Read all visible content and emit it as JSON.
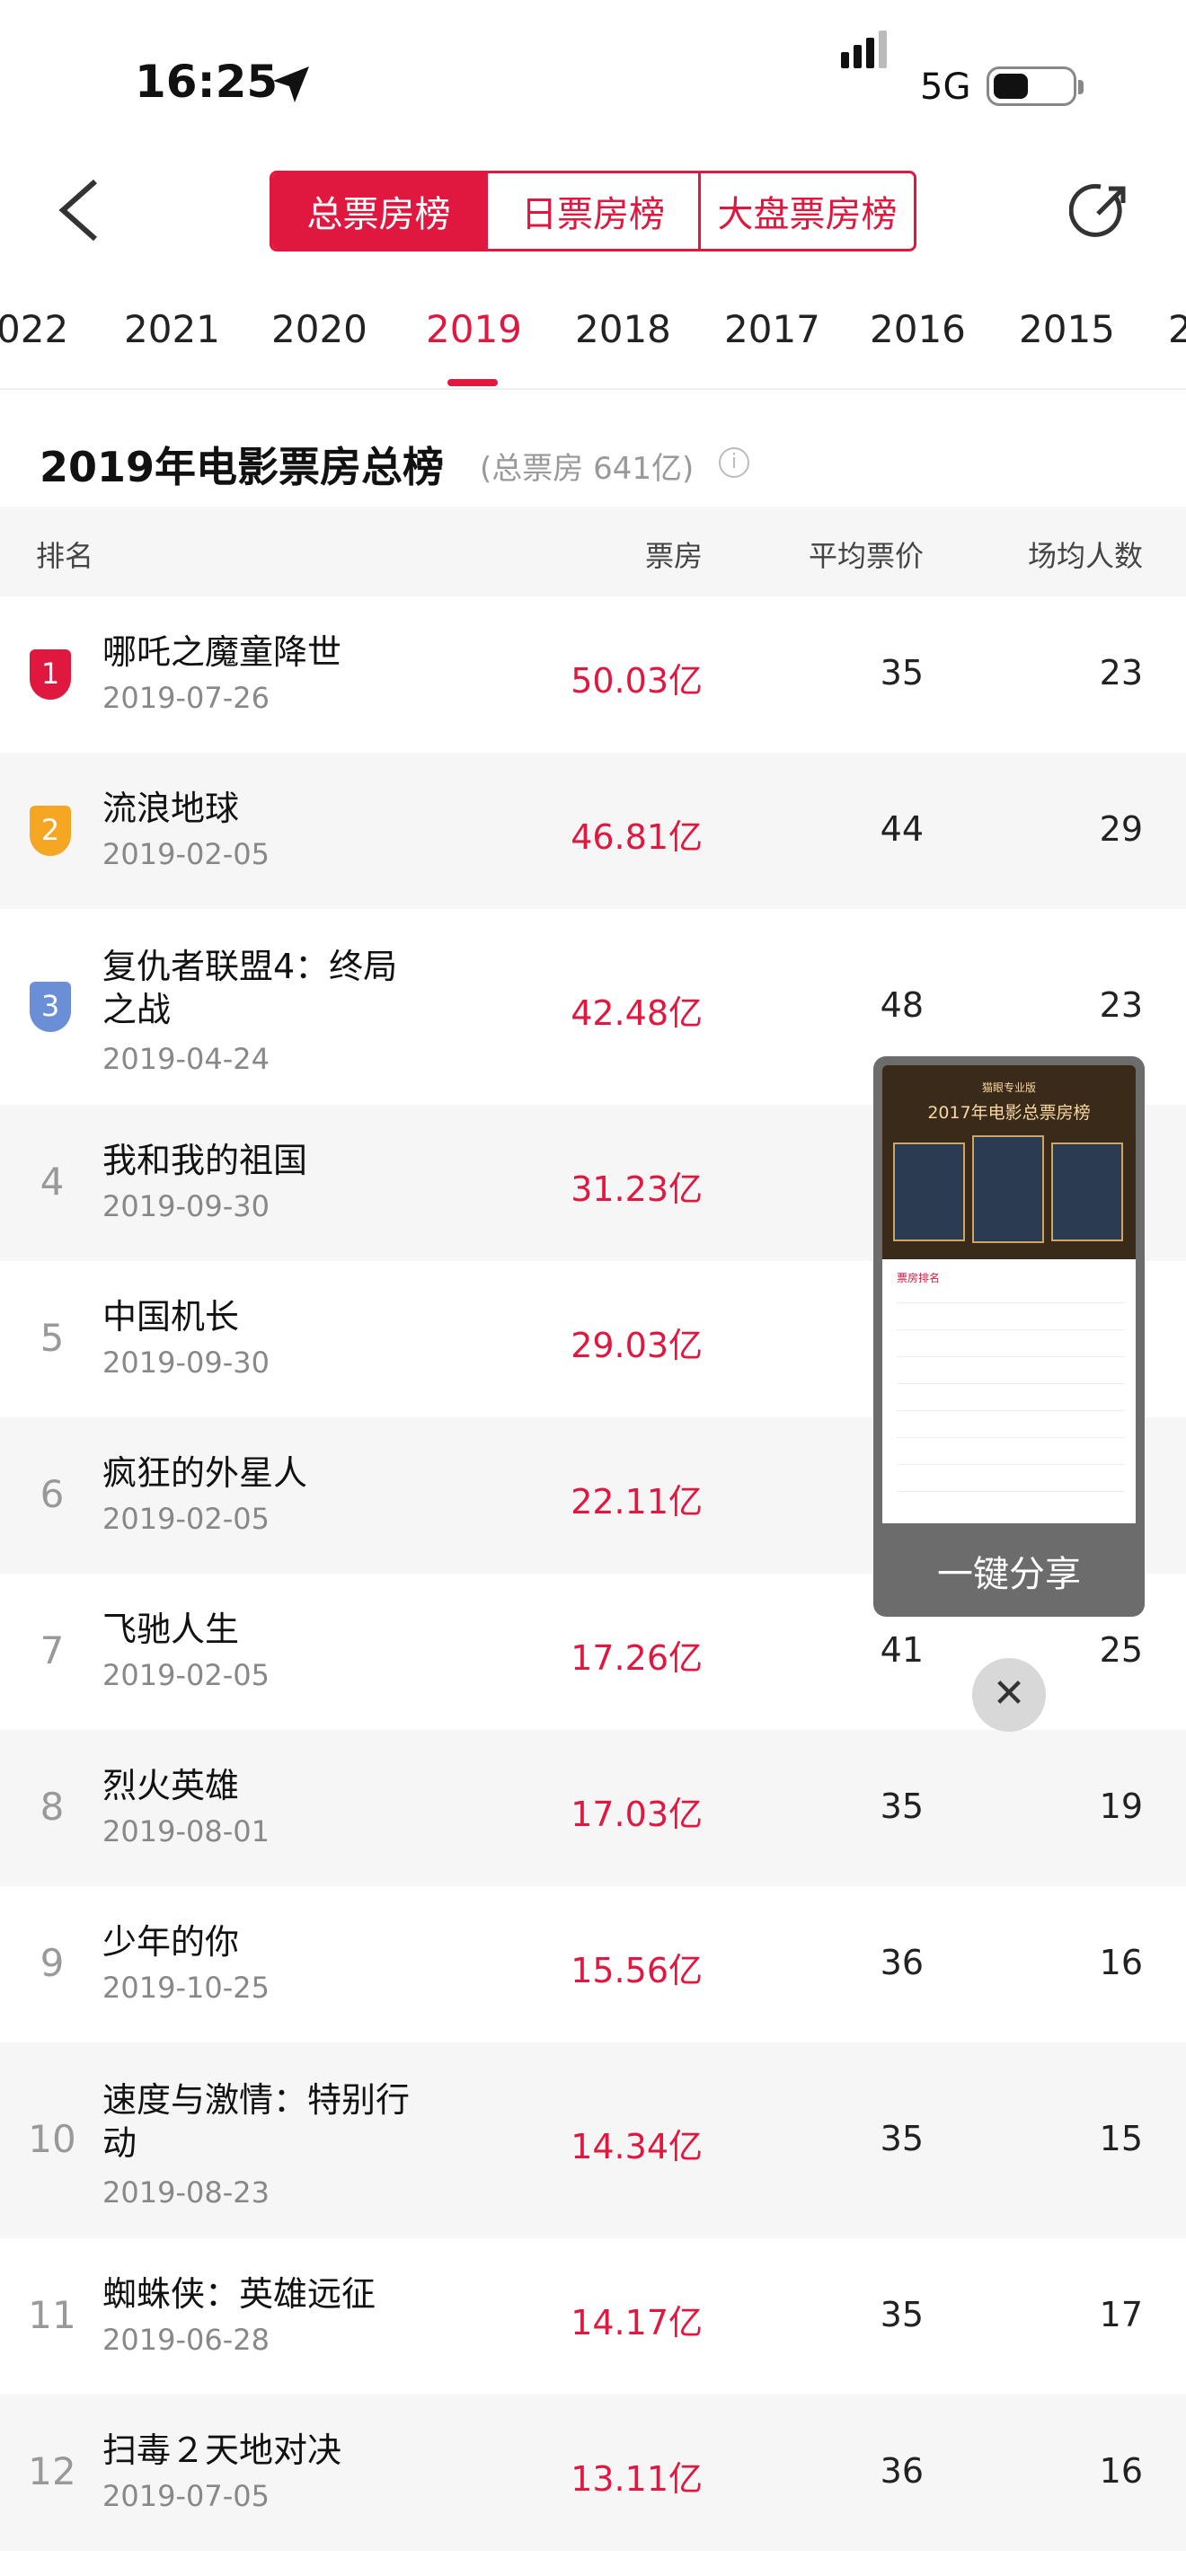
{
  "status_bar": {
    "time": "16:25",
    "network": "5G"
  },
  "header": {
    "tabs": [
      "总票房榜",
      "日票房榜",
      "大盘票房榜"
    ]
  },
  "years": [
    "022",
    "2021",
    "2020",
    "2019",
    "2018",
    "2017",
    "2016",
    "2015",
    "2"
  ],
  "active_year": "2019",
  "title": "2019年电影票房总榜",
  "total": "(总票房 641亿)",
  "table_header": {
    "rank": "排名",
    "box": "票房",
    "price": "平均票价",
    "people": "场均人数"
  },
  "movies": [
    {
      "rank": "1",
      "name": "哪吒之魔童降世",
      "date": "2019-07-26",
      "box": "50.03亿",
      "price": "35",
      "people": "23"
    },
    {
      "rank": "2",
      "name": "流浪地球",
      "date": "2019-02-05",
      "box": "46.81亿",
      "price": "44",
      "people": "29"
    },
    {
      "rank": "3",
      "name": "复仇者联盟4：终局之战",
      "date": "2019-04-24",
      "box": "42.48亿",
      "price": "48",
      "people": "23"
    },
    {
      "rank": "4",
      "name": "我和我的祖国",
      "date": "2019-09-30",
      "box": "31.23亿",
      "price": "",
      "people": ""
    },
    {
      "rank": "5",
      "name": "中国机长",
      "date": "2019-09-30",
      "box": "29.03亿",
      "price": "",
      "people": ""
    },
    {
      "rank": "6",
      "name": "疯狂的外星人",
      "date": "2019-02-05",
      "box": "22.11亿",
      "price": "",
      "people": ""
    },
    {
      "rank": "7",
      "name": "飞驰人生",
      "date": "2019-02-05",
      "box": "17.26亿",
      "price": "41",
      "people": "25"
    },
    {
      "rank": "8",
      "name": "烈火英雄",
      "date": "2019-08-01",
      "box": "17.03亿",
      "price": "35",
      "people": "19"
    },
    {
      "rank": "9",
      "name": "少年的你",
      "date": "2019-10-25",
      "box": "15.56亿",
      "price": "36",
      "people": "16"
    },
    {
      "rank": "10",
      "name": "速度与激情：特别行动",
      "date": "2019-08-23",
      "box": "14.34亿",
      "price": "35",
      "people": "15"
    },
    {
      "rank": "11",
      "name": "蜘蛛侠：英雄远征",
      "date": "2019-06-28",
      "box": "14.17亿",
      "price": "35",
      "people": "17"
    },
    {
      "rank": "12",
      "name": "扫毒２天地对决",
      "date": "2019-07-05",
      "box": "13.11亿",
      "price": "36",
      "people": "16"
    }
  ],
  "share_card": {
    "preview_title": "2017年电影总票房榜",
    "preview_logo": "猫眼专业版",
    "preview_list_header": "票房排名",
    "button": "一键分享"
  },
  "colors": {
    "accent": "#e0173f",
    "gold": "#f5a623",
    "silver": "#6b8fd6"
  }
}
